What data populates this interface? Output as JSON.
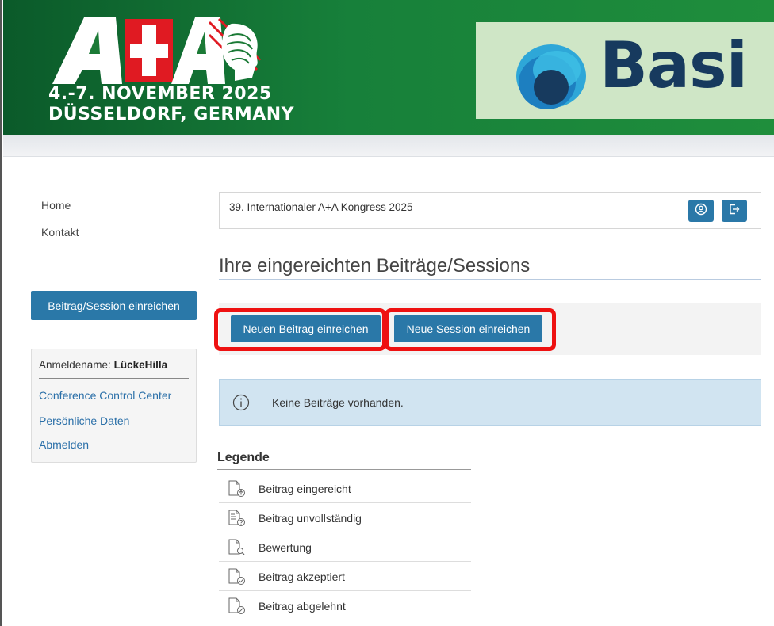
{
  "banner": {
    "logo_text": "A+A",
    "date_line": "4.-7. NOVEMBER 2025",
    "location_line": "DÜSSELDORF, GERMANY",
    "sponsor_text": "Basi",
    "colors": {
      "green_dark": "#0b5a2a",
      "green": "#1f8e3c",
      "sponsor_bg": "#cfe6c6",
      "sponsor_text": "#173a5e"
    }
  },
  "sidebar": {
    "nav": [
      {
        "label": "Home"
      },
      {
        "label": "Kontakt"
      }
    ],
    "submit_button": "Beitrag/Session einreichen",
    "user_panel": {
      "login_label": "Anmeldename:",
      "login_name": "LückeHilla",
      "links": [
        {
          "label": "Conference Control Center"
        },
        {
          "label": "Persönliche Daten"
        },
        {
          "label": "Abmelden"
        }
      ]
    }
  },
  "main": {
    "congress_title": "39. Internationaler A+A Kongress 2025",
    "page_title": "Ihre eingereichten Beiträge/Sessions",
    "actions": {
      "new_contribution": "Neuen Beitrag einreichen",
      "new_session": "Neue Session einreichen"
    },
    "info_message": "Keine Beiträge vorhanden.",
    "legend": {
      "title": "Legende",
      "items": [
        {
          "label": "Beitrag eingereicht",
          "icon": "doc-upload-icon"
        },
        {
          "label": "Beitrag unvollständig",
          "icon": "doc-question-icon"
        },
        {
          "label": "Bewertung",
          "icon": "doc-search-icon"
        },
        {
          "label": "Beitrag akzeptiert",
          "icon": "doc-check-icon"
        },
        {
          "label": "Beitrag abgelehnt",
          "icon": "doc-rejected-icon"
        }
      ]
    }
  },
  "colors": {
    "accent": "#2a78a8",
    "highlight": "#ee1111",
    "info_bg": "#d1e4f1"
  }
}
